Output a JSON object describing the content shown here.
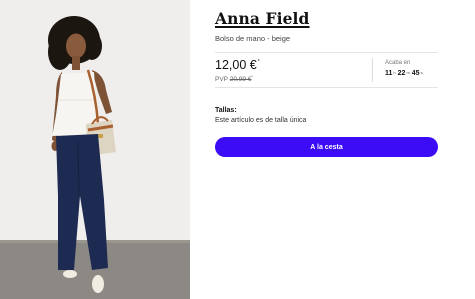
{
  "product": {
    "brand": "Anna Field",
    "name": "Bolso de mano - beige",
    "image_alt": "Modelo con top blanco, vaqueros azul oscuro y bolso beige con asa marrón"
  },
  "pricing": {
    "price": "12,00 €",
    "price_marker": "*",
    "rrp_prefix": "PVP",
    "rrp_value": "20,99 €",
    "rrp_marker": "*"
  },
  "countdown": {
    "label": "Acaba en",
    "hours": "11",
    "hours_unit": "h",
    "minutes": "22",
    "minutes_unit": "m",
    "seconds": "45",
    "seconds_unit": "s"
  },
  "sizes": {
    "label": "Tallas:",
    "value": "Este artículo es de talla única"
  },
  "cta": {
    "label": "A la cesta"
  },
  "colors": {
    "accent": "#3b0cf5",
    "text": "#1a1a1a",
    "photo_background": "#ecebe8",
    "floor": "#8a8782"
  }
}
